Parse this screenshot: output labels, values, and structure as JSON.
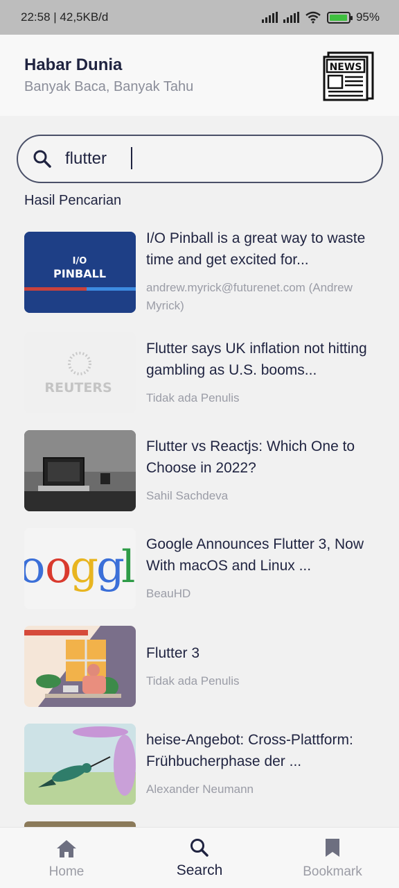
{
  "status_bar": {
    "time_info": "22:58 | 42,5KB/d",
    "battery_percent": "95%",
    "battery_level": 0.95
  },
  "header": {
    "title": "Habar Dunia",
    "subtitle": "Banyak Baca, Banyak Tahu",
    "logo_text": "NEWS"
  },
  "search": {
    "value": "flutter",
    "placeholder": ""
  },
  "results_title": "Hasil Pencarian",
  "results": [
    {
      "title": "I/O Pinball is a great way to waste time and get excited for...",
      "author": "andrew.myrick@futurenet.com (Andrew Myrick)",
      "thumb_text": "I/O PINBALL",
      "thumb_icon": "pinball-thumbnail"
    },
    {
      "title": "Flutter says UK inflation not hitting gambling as U.S. booms...",
      "author": "Tidak ada Penulis",
      "thumb_text": "REUTERS",
      "thumb_icon": "reuters-thumbnail"
    },
    {
      "title": "Flutter vs Reactjs: Which One to Choose in 2022?",
      "author": "Sahil Sachdeva",
      "thumb_text": "",
      "thumb_icon": "laptop-thumbnail"
    },
    {
      "title": "Google Announces Flutter 3, Now With macOS and Linux ...",
      "author": "BeauHD",
      "thumb_text": "Google",
      "thumb_icon": "google-thumbnail"
    },
    {
      "title": "Flutter 3",
      "author": "Tidak ada Penulis",
      "thumb_text": "",
      "thumb_icon": "flutter3-thumbnail"
    },
    {
      "title": "heise-Angebot: Cross-Plattform: Frühbucherphase der ...",
      "author": "Alexander Neumann",
      "thumb_text": "",
      "thumb_icon": "hummingbird-thumbnail"
    }
  ],
  "nav": {
    "home": {
      "label": "Home",
      "icon": "home-icon"
    },
    "search": {
      "label": "Search",
      "icon": "search-icon"
    },
    "bookmark": {
      "label": "Bookmark",
      "icon": "bookmark-icon"
    }
  },
  "colors": {
    "primary": "#1f2340",
    "muted": "#9a9ca6",
    "background": "#f1f1f1"
  }
}
